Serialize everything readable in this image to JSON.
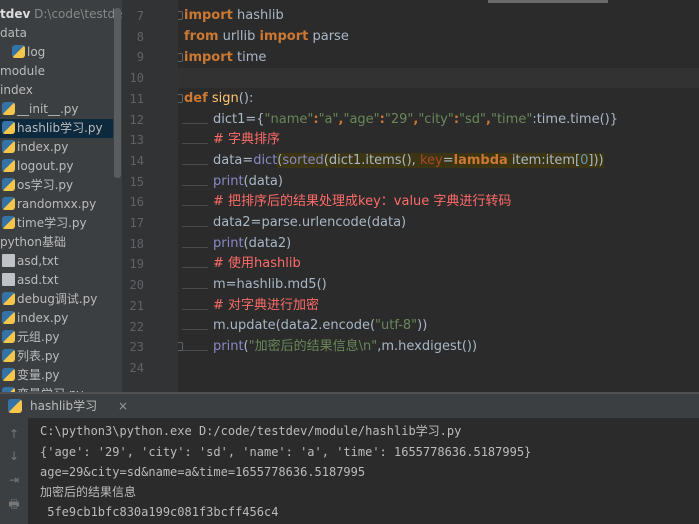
{
  "project": {
    "root_name": "tdev",
    "root_path": "D:\\code\\testdev",
    "items": [
      {
        "label": "data",
        "kind": "folder"
      },
      {
        "label": "log",
        "kind": "py"
      },
      {
        "label": "module",
        "kind": "folder"
      },
      {
        "label": "index",
        "kind": "folder"
      },
      {
        "label": "__init__.py",
        "kind": "py"
      },
      {
        "label": "hashlib学习.py",
        "kind": "py",
        "selected": true
      },
      {
        "label": "index.py",
        "kind": "py"
      },
      {
        "label": "logout.py",
        "kind": "py"
      },
      {
        "label": "os学习.py",
        "kind": "py"
      },
      {
        "label": "randomxx.py",
        "kind": "py"
      },
      {
        "label": "time学习.py",
        "kind": "py"
      },
      {
        "label": "python基础",
        "kind": "folder"
      },
      {
        "label": "asd,txt",
        "kind": "txt"
      },
      {
        "label": "asd.txt",
        "kind": "txt"
      },
      {
        "label": "debug调试.py",
        "kind": "py"
      },
      {
        "label": "index.py",
        "kind": "py"
      },
      {
        "label": "元组.py",
        "kind": "py"
      },
      {
        "label": "列表.py",
        "kind": "py"
      },
      {
        "label": "变量.py",
        "kind": "py"
      },
      {
        "label": "变量学习.py",
        "kind": "py"
      }
    ]
  },
  "editor": {
    "line_numbers": [
      "7",
      "8",
      "9",
      "10",
      "11",
      "12",
      "13",
      "14",
      "15",
      "16",
      "17",
      "18",
      "19",
      "20",
      "21",
      "22",
      "23",
      "24"
    ],
    "lines": {
      "l7_kw": "import",
      "l7_rest": " hashlib",
      "l8_kw1": "from",
      "l8_mid": " urllib ",
      "l8_kw2": "import",
      "l8_rest": " parse",
      "l9_kw": "import",
      "l9_rest": " time",
      "l11_kw": "def",
      "l11_fn": " sign",
      "l11_rest": "():",
      "l12_a": "dict1={",
      "l12_s1": "\"name\"",
      "l12_c1": ":",
      "l12_s2": "\"a\"",
      "l12_c2": ",",
      "l12_s3": "\"age\"",
      "l12_c3": ":",
      "l12_s4": "\"29\"",
      "l12_c4": ",",
      "l12_s5": "\"city\"",
      "l12_c5": ":",
      "l12_s6": "\"sd\"",
      "l12_c6": ",",
      "l12_s7": "\"time\"",
      "l12_c7": ":time.time()}",
      "l13": "# 字典排序",
      "l14_a": "data=",
      "l14_b1": "dict",
      "l14_b": "(",
      "l14_b2": "sorted",
      "l14_c": "(dict1.items(), ",
      "l14_key": "key",
      "l14_d": "=",
      "l14_kw": "lambda",
      "l14_e": " item:item[",
      "l14_num": "0",
      "l14_f": "]))",
      "l15_bi": "print",
      "l15_rest": "(data)",
      "l16": "# 把排序后的结果处理成key：value 字典进行转码",
      "l17": "data2=parse.urlencode(data)",
      "l18_bi": "print",
      "l18_rest": "(data2)",
      "l19": "# 使用hashlib",
      "l20": "m=hashlib.md5()",
      "l21": "# 对字典进行加密",
      "l22_a": "m.update(data2.encode(",
      "l22_s": "\"utf-8\"",
      "l22_b": "))",
      "l23_bi": "print",
      "l23_a": "(",
      "l23_s": "\"加密后的结果信息\\n\"",
      "l23_b": ",m.hexdigest())"
    }
  },
  "run": {
    "tab_label": "hashlib学习",
    "close": "×",
    "toolbar": [
      "↑",
      "↓",
      "⇥",
      "🖶"
    ],
    "output": [
      "C:\\python3\\python.exe D:/code/testdev/module/hashlib学习.py",
      "{'age': '29', 'city': 'sd', 'name': 'a', 'time': 1655778636.5187995}",
      "age=29&city=sd&name=a&time=1655778636.5187995",
      "加密后的结果信息",
      " 5fe9cb1bfc830a199c081f3bcff456c4"
    ]
  },
  "colors": {
    "keyword": "#cc7832",
    "string": "#6a8759",
    "comment": "#ff6b68",
    "function": "#ffc66d",
    "builtin": "#8888c6",
    "number": "#6897bb"
  }
}
